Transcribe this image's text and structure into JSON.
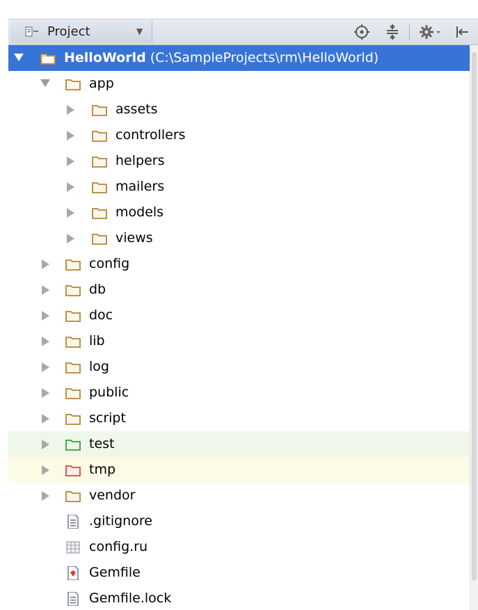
{
  "toolbar": {
    "view_label": "Project",
    "icons": [
      "locate-icon",
      "collapse-all-icon",
      "settings-icon",
      "hide-icon"
    ]
  },
  "colors": {
    "selection": "#3874d8",
    "folder": "#b5843a",
    "test_folder": "#3b9b3b",
    "excluded_folder": "#cf4a3a",
    "test_row_bg": "#eef7ea",
    "excluded_row_bg": "#fbfbe6"
  },
  "tree": {
    "root": {
      "name": "HelloWorld",
      "path": "(C:\\SampleProjects\\rm\\HelloWorld)"
    },
    "app": {
      "name": "app",
      "children": [
        "assets",
        "controllers",
        "helpers",
        "mailers",
        "models",
        "views"
      ]
    },
    "folders": [
      "config",
      "db",
      "doc",
      "lib",
      "log",
      "public",
      "script"
    ],
    "test": "test",
    "tmp": "tmp",
    "vendor": "vendor",
    "files": [
      {
        "name": ".gitignore",
        "icon": "text-file-icon"
      },
      {
        "name": "config.ru",
        "icon": "ruby-config-file-icon"
      },
      {
        "name": "Gemfile",
        "icon": "gemfile-icon"
      },
      {
        "name": "Gemfile.lock",
        "icon": "text-file-icon"
      }
    ]
  }
}
